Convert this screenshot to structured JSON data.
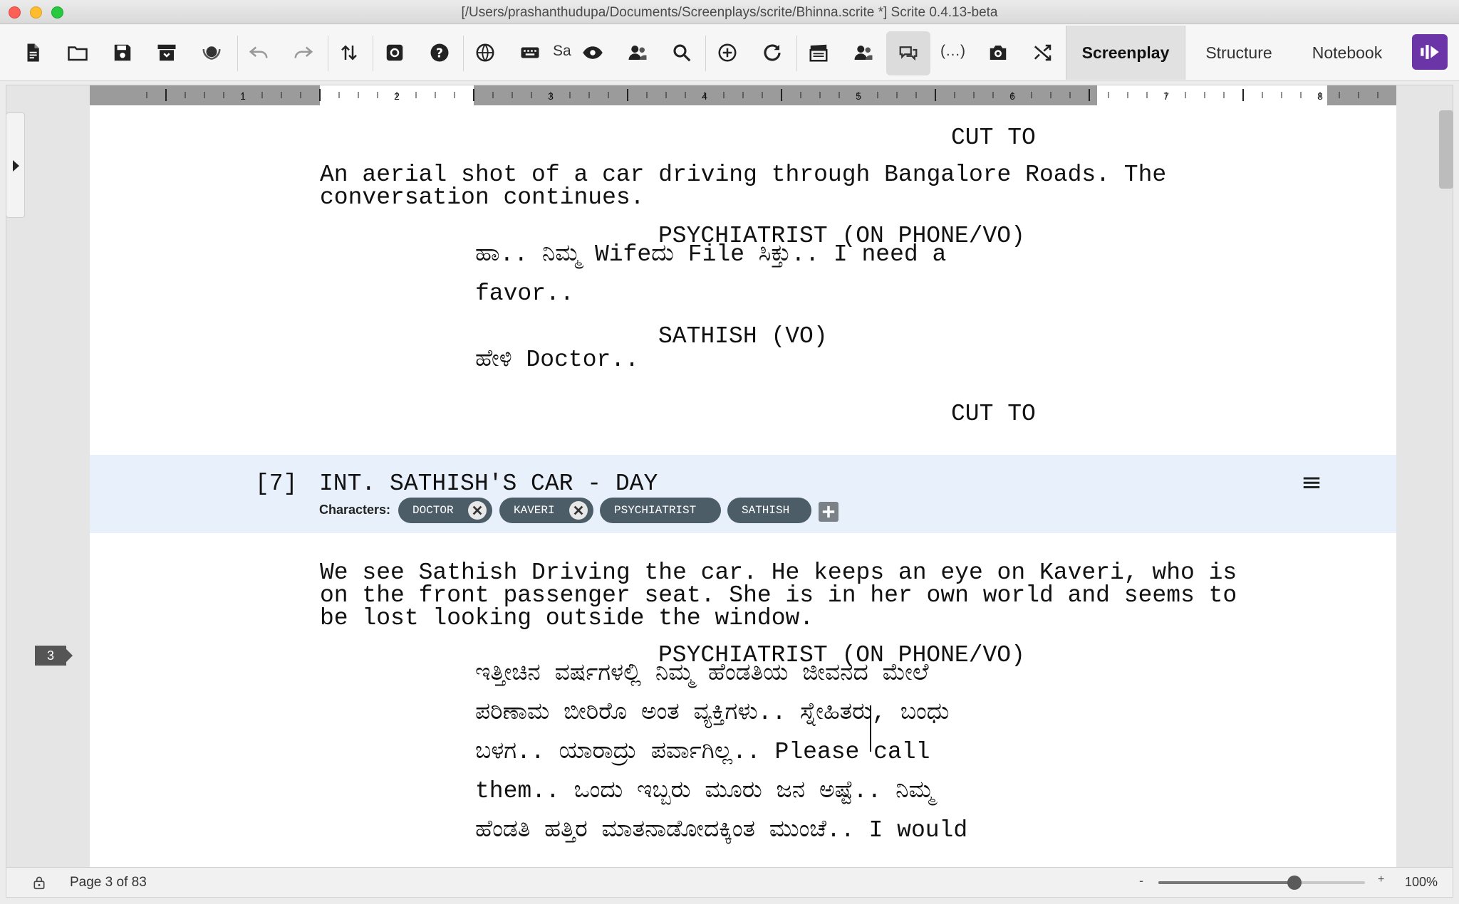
{
  "window": {
    "title": "[/Users/prashanthudupa/Documents/Screenplays/scrite/Bhinna.scrite *] Scrite 0.4.13-beta"
  },
  "toolbar": {
    "icons": [
      "new-file-icon",
      "open-folder-icon",
      "save-icon",
      "archive-icon",
      "awards-icon",
      "undo-icon",
      "redo-icon",
      "import-export-icon",
      "settings-icon",
      "help-icon",
      "language-icon",
      "keyboard-icon",
      "eye-icon",
      "characters-icon",
      "search-icon",
      "add-scene-icon",
      "refresh-icon",
      "clapperboard-icon",
      "character-report-icon",
      "comments-icon",
      "parenthetical-icon",
      "screenshot-icon",
      "shuffle-icon"
    ],
    "sample_text": "Sa",
    "parenthetical_text": "(…)",
    "modes": {
      "screenplay": "Screenplay",
      "structure": "Structure",
      "notebook": "Notebook"
    },
    "active_mode": "Screenplay"
  },
  "ruler": {
    "numbers": [
      "1",
      "2",
      "3",
      "4",
      "5",
      "6",
      "7",
      "8"
    ]
  },
  "screenplay": {
    "transition_1": "CUT TO",
    "action_1": "An aerial shot of a car driving through Bangalore Roads. The\nconversation continues.",
    "character_1": "PSYCHIATRIST (ON PHONE/VO)",
    "dialogue_1": "ಹಾ.. ನಿಮ್ಮ Wifeದು File ಸಿಕ್ತು.. I need a\nfavor..",
    "character_2": "SATHISH (VO)",
    "dialogue_2": "ಹೇಳಿ Doctor..",
    "transition_2": "CUT TO",
    "scene": {
      "number": "[7]",
      "heading": "INT. SATHISH'S CAR - DAY",
      "characters_label": "Characters:",
      "characters": [
        "DOCTOR",
        "KAVERI",
        "PSYCHIATRIST",
        "SATHISH"
      ]
    },
    "action_2": "We see Sathish Driving the car. He keeps an eye on Kaveri, who is\non the front passenger seat. She is in her own world and seems to\nbe lost looking outside the window.",
    "character_3": "PSYCHIATRIST (ON PHONE/VO)",
    "dialogue_3": "ಇತ್ತೀಚಿನ ವರ್ಷಗಳಲ್ಲಿ ನಿಮ್ಮ ಹೆಂಡತಿಯ ಜೀವನದ ಮೇಲೆ\nಪರಿಣಾಮ ಬೀರಿರೊ ಅಂತ ವ್ಯಕ್ತಿಗಳು.. ಸ್ನೇಹಿತರು, ಬಂಧು\nಬಳಗ.. ಯಾರಾದ್ರು ಪರ್ವಾಗಿಲ್ಲ.. Please call\nthem.. ಒಂದು ಇಬ್ಬರು ಮೂರು ಜನ ಅಷ್ಟೆ.. ನಿಮ್ಮ\nಹೆಂಡತಿ ಹತ್ತಿರ ಮಾತನಾಡೋದಕ್ಕಿಂತ ಮುಂಚೆ.. I would",
    "page_marker": "3"
  },
  "statusbar": {
    "page_info": "Page 3 of 83",
    "zoom_minus": "-",
    "zoom_plus": "+",
    "zoom_value": "100%",
    "zoom_level_fraction": 0.66
  },
  "colors": {
    "scene_header_bg": "#e8f1fb",
    "chip_bg": "#4c5d67",
    "brand": "#6b35a8"
  }
}
